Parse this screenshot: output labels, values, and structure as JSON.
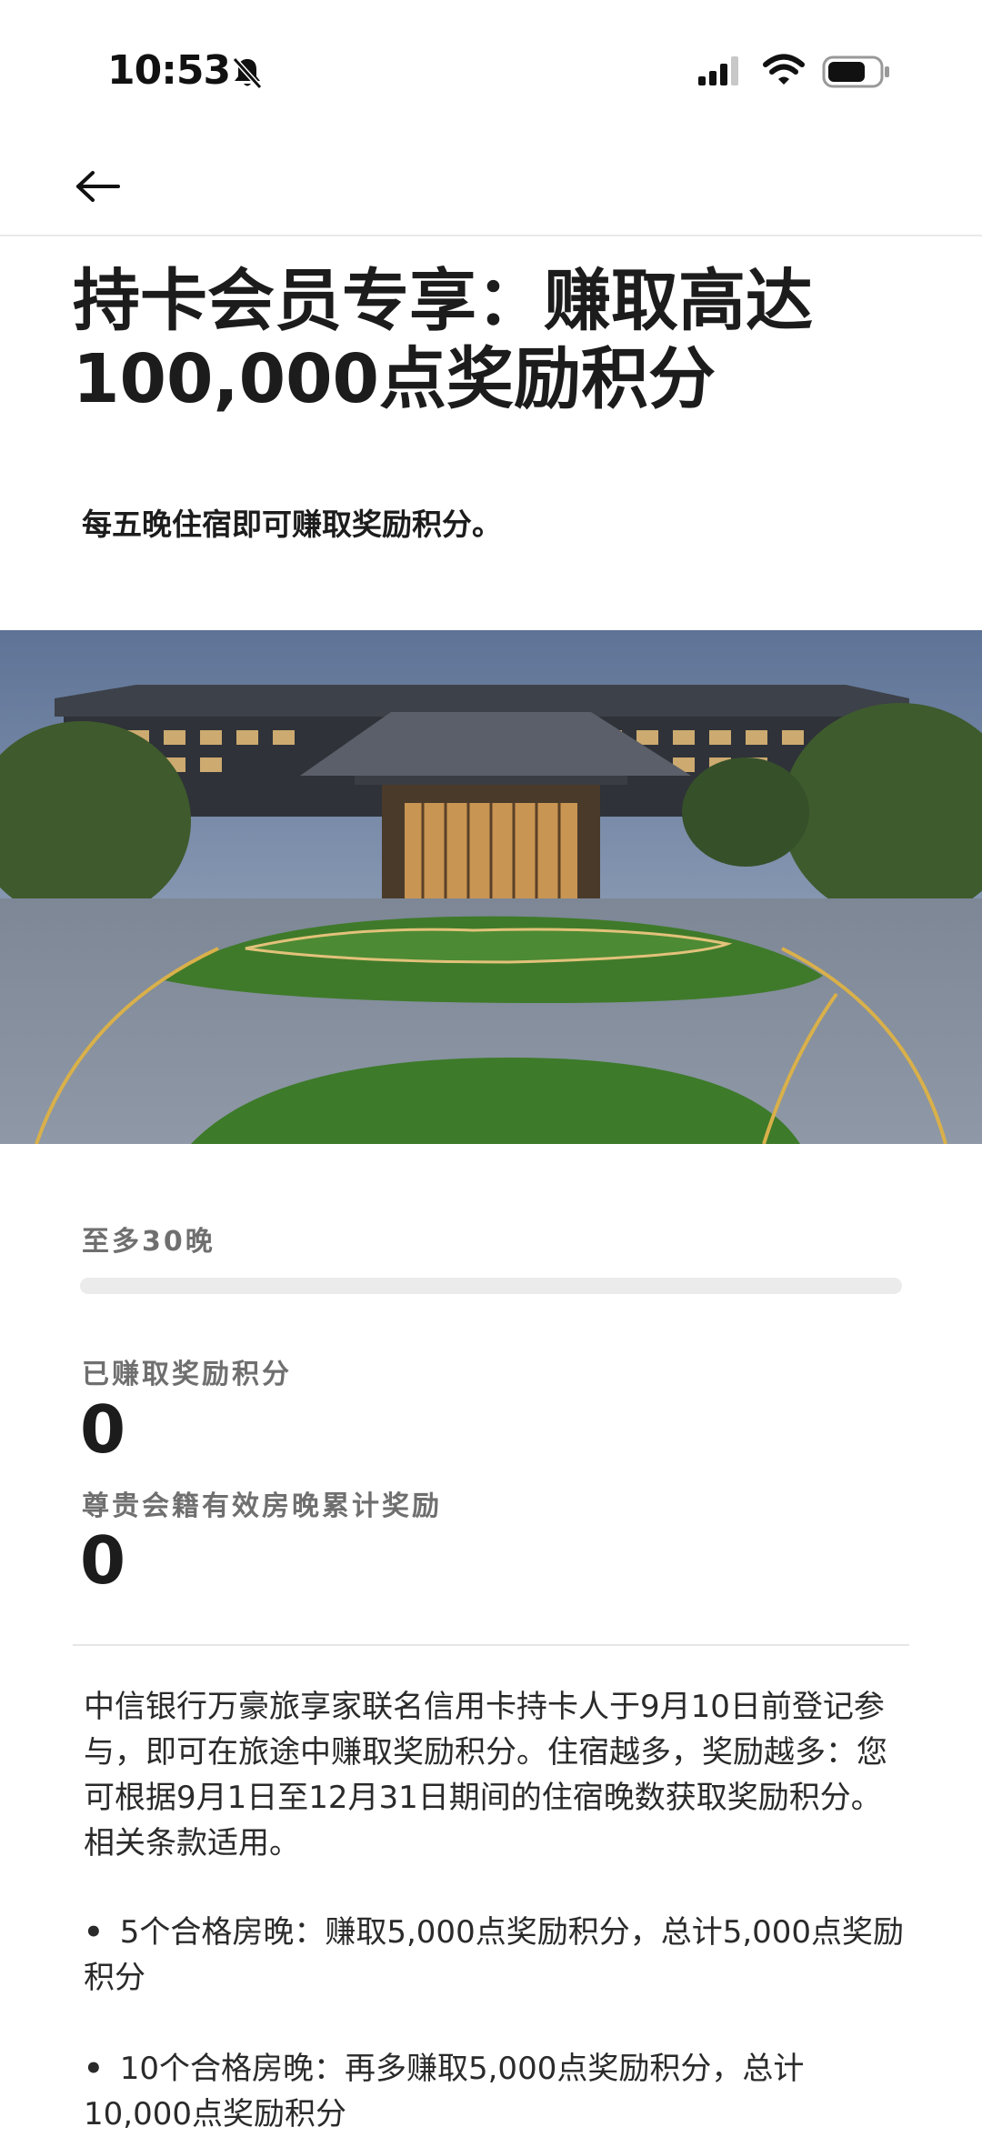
{
  "status_bar": {
    "time": "10:53"
  },
  "header": {
    "back_label": ""
  },
  "page": {
    "title": "持卡会员专享：赚取高达100,000点奖励积分",
    "subtitle": "每五晚住宿即可赚取奖励积分。"
  },
  "progress": {
    "nights_label": "至多30晚",
    "nights_completed": 0,
    "nights_max": 30
  },
  "stats": {
    "earned_label": "已赚取奖励积分",
    "earned_value": "0",
    "elite_label": "尊贵会籍有效房晚累计奖励",
    "elite_value": "0"
  },
  "description": "中信银行万豪旅享家联名信用卡持卡人于9月10日前登记参与，即可在旅途中赚取奖励积分。住宿越多，奖励越多：您可根据9月1日至12月31日期间的住宿晚数获取奖励积分。相关条款适用。",
  "bullets": [
    {
      "dot": "•",
      "text": "5个合格房晚：赚取5,000点奖励积分，总计5,000点奖励积分"
    },
    {
      "dot": "•",
      "text": "10个合格房晚：再多赚取5,000点奖励积分，总计10,000点奖励积分"
    }
  ],
  "icons": {
    "bell": "bell-slash-icon",
    "signal": "cellular-signal-icon",
    "wifi": "wifi-icon",
    "battery": "battery-icon",
    "back": "arrow-left-icon"
  }
}
